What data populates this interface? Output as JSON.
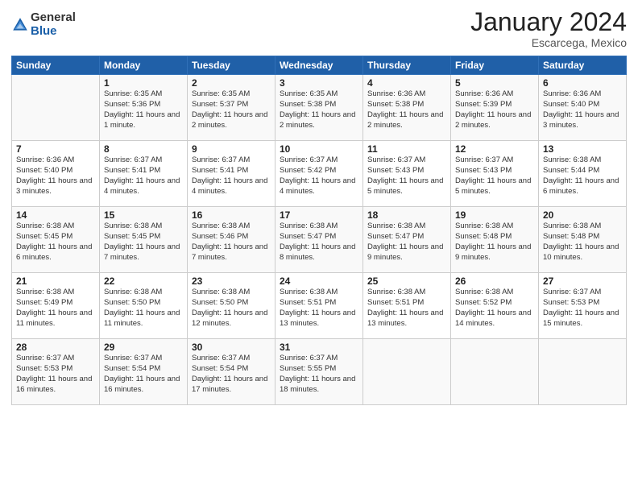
{
  "header": {
    "logo_general": "General",
    "logo_blue": "Blue",
    "title": "January 2024",
    "location": "Escarcega, Mexico"
  },
  "columns": [
    "Sunday",
    "Monday",
    "Tuesday",
    "Wednesday",
    "Thursday",
    "Friday",
    "Saturday"
  ],
  "weeks": [
    [
      {
        "day": "",
        "sunrise": "",
        "sunset": "",
        "daylight": ""
      },
      {
        "day": "1",
        "sunrise": "Sunrise: 6:35 AM",
        "sunset": "Sunset: 5:36 PM",
        "daylight": "Daylight: 11 hours and 1 minute."
      },
      {
        "day": "2",
        "sunrise": "Sunrise: 6:35 AM",
        "sunset": "Sunset: 5:37 PM",
        "daylight": "Daylight: 11 hours and 2 minutes."
      },
      {
        "day": "3",
        "sunrise": "Sunrise: 6:35 AM",
        "sunset": "Sunset: 5:38 PM",
        "daylight": "Daylight: 11 hours and 2 minutes."
      },
      {
        "day": "4",
        "sunrise": "Sunrise: 6:36 AM",
        "sunset": "Sunset: 5:38 PM",
        "daylight": "Daylight: 11 hours and 2 minutes."
      },
      {
        "day": "5",
        "sunrise": "Sunrise: 6:36 AM",
        "sunset": "Sunset: 5:39 PM",
        "daylight": "Daylight: 11 hours and 2 minutes."
      },
      {
        "day": "6",
        "sunrise": "Sunrise: 6:36 AM",
        "sunset": "Sunset: 5:40 PM",
        "daylight": "Daylight: 11 hours and 3 minutes."
      }
    ],
    [
      {
        "day": "7",
        "sunrise": "Sunrise: 6:36 AM",
        "sunset": "Sunset: 5:40 PM",
        "daylight": "Daylight: 11 hours and 3 minutes."
      },
      {
        "day": "8",
        "sunrise": "Sunrise: 6:37 AM",
        "sunset": "Sunset: 5:41 PM",
        "daylight": "Daylight: 11 hours and 4 minutes."
      },
      {
        "day": "9",
        "sunrise": "Sunrise: 6:37 AM",
        "sunset": "Sunset: 5:41 PM",
        "daylight": "Daylight: 11 hours and 4 minutes."
      },
      {
        "day": "10",
        "sunrise": "Sunrise: 6:37 AM",
        "sunset": "Sunset: 5:42 PM",
        "daylight": "Daylight: 11 hours and 4 minutes."
      },
      {
        "day": "11",
        "sunrise": "Sunrise: 6:37 AM",
        "sunset": "Sunset: 5:43 PM",
        "daylight": "Daylight: 11 hours and 5 minutes."
      },
      {
        "day": "12",
        "sunrise": "Sunrise: 6:37 AM",
        "sunset": "Sunset: 5:43 PM",
        "daylight": "Daylight: 11 hours and 5 minutes."
      },
      {
        "day": "13",
        "sunrise": "Sunrise: 6:38 AM",
        "sunset": "Sunset: 5:44 PM",
        "daylight": "Daylight: 11 hours and 6 minutes."
      }
    ],
    [
      {
        "day": "14",
        "sunrise": "Sunrise: 6:38 AM",
        "sunset": "Sunset: 5:45 PM",
        "daylight": "Daylight: 11 hours and 6 minutes."
      },
      {
        "day": "15",
        "sunrise": "Sunrise: 6:38 AM",
        "sunset": "Sunset: 5:45 PM",
        "daylight": "Daylight: 11 hours and 7 minutes."
      },
      {
        "day": "16",
        "sunrise": "Sunrise: 6:38 AM",
        "sunset": "Sunset: 5:46 PM",
        "daylight": "Daylight: 11 hours and 7 minutes."
      },
      {
        "day": "17",
        "sunrise": "Sunrise: 6:38 AM",
        "sunset": "Sunset: 5:47 PM",
        "daylight": "Daylight: 11 hours and 8 minutes."
      },
      {
        "day": "18",
        "sunrise": "Sunrise: 6:38 AM",
        "sunset": "Sunset: 5:47 PM",
        "daylight": "Daylight: 11 hours and 9 minutes."
      },
      {
        "day": "19",
        "sunrise": "Sunrise: 6:38 AM",
        "sunset": "Sunset: 5:48 PM",
        "daylight": "Daylight: 11 hours and 9 minutes."
      },
      {
        "day": "20",
        "sunrise": "Sunrise: 6:38 AM",
        "sunset": "Sunset: 5:48 PM",
        "daylight": "Daylight: 11 hours and 10 minutes."
      }
    ],
    [
      {
        "day": "21",
        "sunrise": "Sunrise: 6:38 AM",
        "sunset": "Sunset: 5:49 PM",
        "daylight": "Daylight: 11 hours and 11 minutes."
      },
      {
        "day": "22",
        "sunrise": "Sunrise: 6:38 AM",
        "sunset": "Sunset: 5:50 PM",
        "daylight": "Daylight: 11 hours and 11 minutes."
      },
      {
        "day": "23",
        "sunrise": "Sunrise: 6:38 AM",
        "sunset": "Sunset: 5:50 PM",
        "daylight": "Daylight: 11 hours and 12 minutes."
      },
      {
        "day": "24",
        "sunrise": "Sunrise: 6:38 AM",
        "sunset": "Sunset: 5:51 PM",
        "daylight": "Daylight: 11 hours and 13 minutes."
      },
      {
        "day": "25",
        "sunrise": "Sunrise: 6:38 AM",
        "sunset": "Sunset: 5:51 PM",
        "daylight": "Daylight: 11 hours and 13 minutes."
      },
      {
        "day": "26",
        "sunrise": "Sunrise: 6:38 AM",
        "sunset": "Sunset: 5:52 PM",
        "daylight": "Daylight: 11 hours and 14 minutes."
      },
      {
        "day": "27",
        "sunrise": "Sunrise: 6:37 AM",
        "sunset": "Sunset: 5:53 PM",
        "daylight": "Daylight: 11 hours and 15 minutes."
      }
    ],
    [
      {
        "day": "28",
        "sunrise": "Sunrise: 6:37 AM",
        "sunset": "Sunset: 5:53 PM",
        "daylight": "Daylight: 11 hours and 16 minutes."
      },
      {
        "day": "29",
        "sunrise": "Sunrise: 6:37 AM",
        "sunset": "Sunset: 5:54 PM",
        "daylight": "Daylight: 11 hours and 16 minutes."
      },
      {
        "day": "30",
        "sunrise": "Sunrise: 6:37 AM",
        "sunset": "Sunset: 5:54 PM",
        "daylight": "Daylight: 11 hours and 17 minutes."
      },
      {
        "day": "31",
        "sunrise": "Sunrise: 6:37 AM",
        "sunset": "Sunset: 5:55 PM",
        "daylight": "Daylight: 11 hours and 18 minutes."
      },
      {
        "day": "",
        "sunrise": "",
        "sunset": "",
        "daylight": ""
      },
      {
        "day": "",
        "sunrise": "",
        "sunset": "",
        "daylight": ""
      },
      {
        "day": "",
        "sunrise": "",
        "sunset": "",
        "daylight": ""
      }
    ]
  ]
}
